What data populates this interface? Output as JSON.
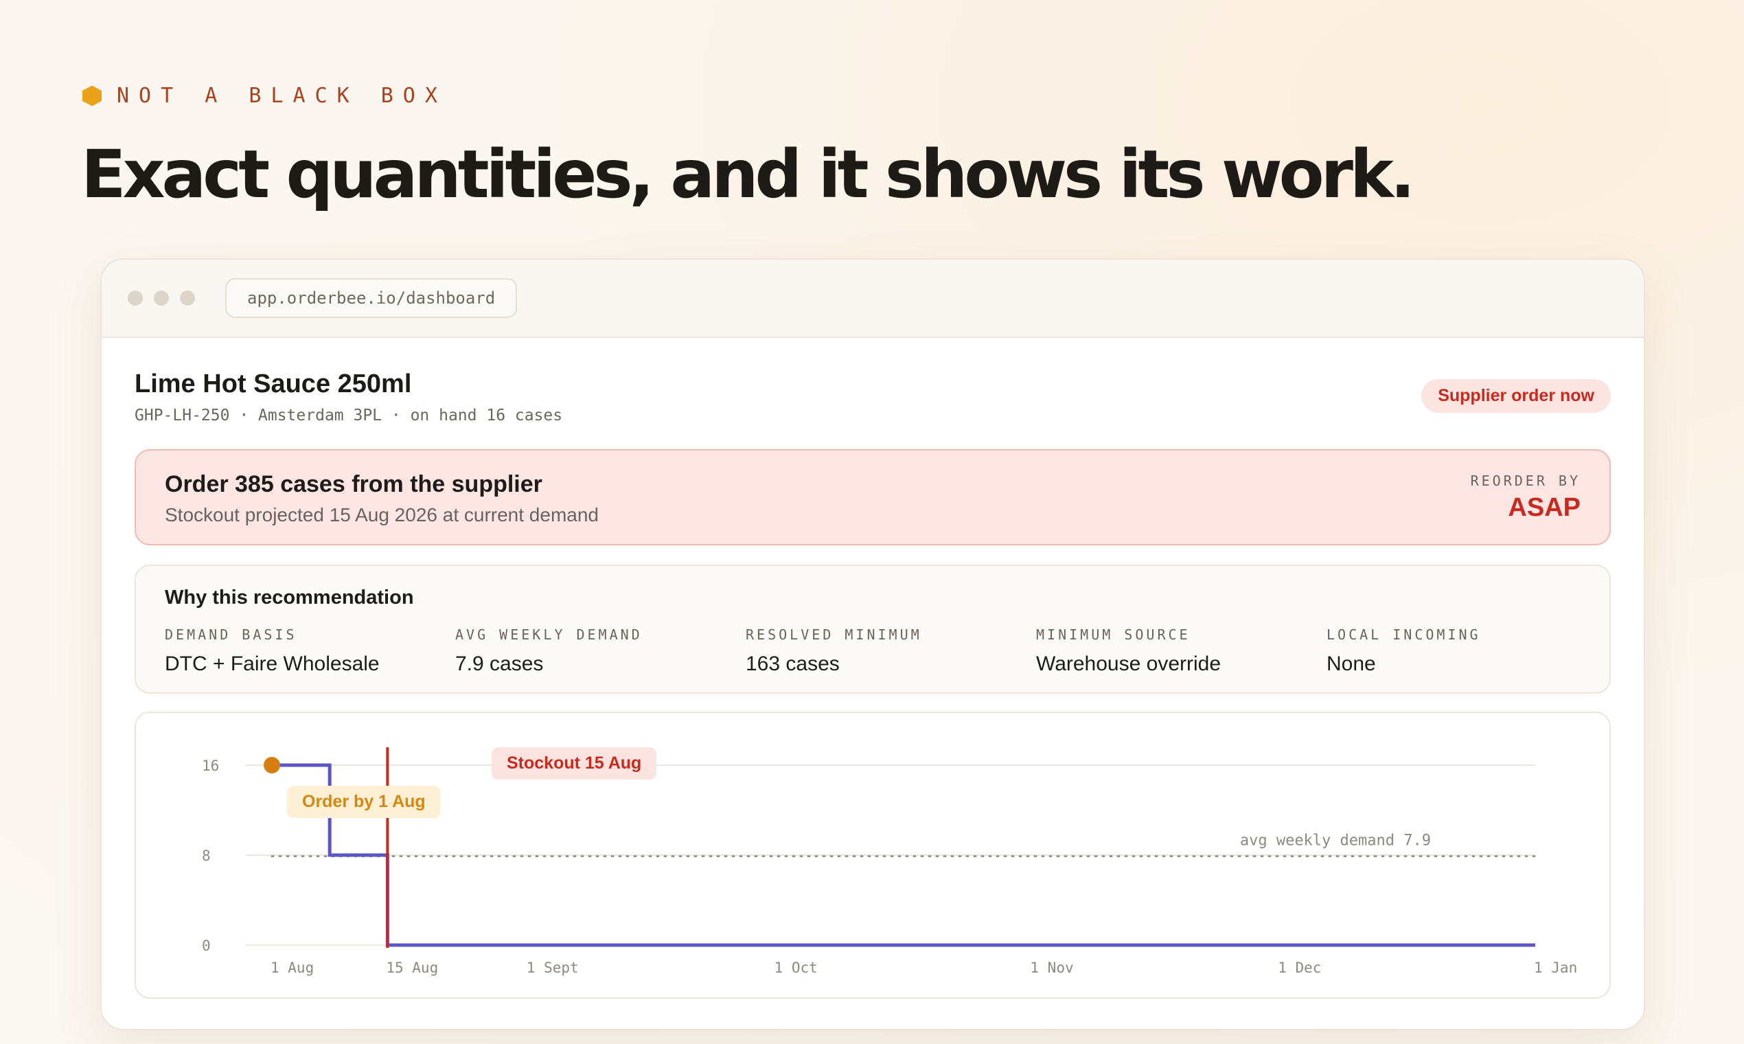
{
  "eyebrow": "NOT A BLACK BOX",
  "headline": "Exact quantities, and it shows its work.",
  "browser": {
    "url": "app.orderbee.io/dashboard"
  },
  "product": {
    "title": "Lime Hot Sauce 250ml",
    "meta": "GHP-LH-250 · Amsterdam 3PL · on hand 16 cases",
    "badge": "Supplier order now"
  },
  "alert": {
    "title": "Order 385 cases from the supplier",
    "subtitle": "Stockout projected 15 Aug 2026 at current demand",
    "reorder_label": "REORDER BY",
    "reorder_value": "ASAP"
  },
  "why": {
    "title": "Why this recommendation",
    "stats": [
      {
        "label": "DEMAND BASIS",
        "value": "DTC + Faire Wholesale"
      },
      {
        "label": "AVG WEEKLY DEMAND",
        "value": "7.9 cases"
      },
      {
        "label": "RESOLVED MINIMUM",
        "value": "163 cases"
      },
      {
        "label": "MINIMUM SOURCE",
        "value": "Warehouse override"
      },
      {
        "label": "LOCAL INCOMING",
        "value": "None"
      }
    ]
  },
  "colors": {
    "accent": "#e9a21a",
    "eyebrow": "#a8421f",
    "danger": "#c92a1f",
    "line": "#5b55c9",
    "order_marker": "#d67f10"
  },
  "chart_data": {
    "type": "line",
    "title": "",
    "xlabel": "",
    "ylabel": "",
    "x_ticks": [
      "1 Aug",
      "15 Aug",
      "1 Sept",
      "1 Oct",
      "1 Nov",
      "1 Dec",
      "1 Jan"
    ],
    "y_ticks": [
      0,
      8,
      16
    ],
    "ylim": [
      0,
      16
    ],
    "grid": true,
    "series": [
      {
        "step": true,
        "points": [
          {
            "x": "1 Aug",
            "y": 16
          },
          {
            "x": "8 Aug",
            "y": 16
          },
          {
            "x": "8 Aug",
            "y": 8
          },
          {
            "x": "15 Aug",
            "y": 8
          },
          {
            "x": "15 Aug",
            "y": 0
          },
          {
            "x": "1 Jan",
            "y": 0
          }
        ]
      }
    ],
    "reference_line": {
      "label": "avg weekly demand 7.9",
      "y": 7.9
    },
    "annotations": [
      {
        "type": "marker",
        "x": "1 Aug",
        "y": 16,
        "label": "Order by 1 Aug"
      },
      {
        "type": "vline",
        "x": "15 Aug",
        "label": "Stockout 15 Aug"
      }
    ]
  }
}
